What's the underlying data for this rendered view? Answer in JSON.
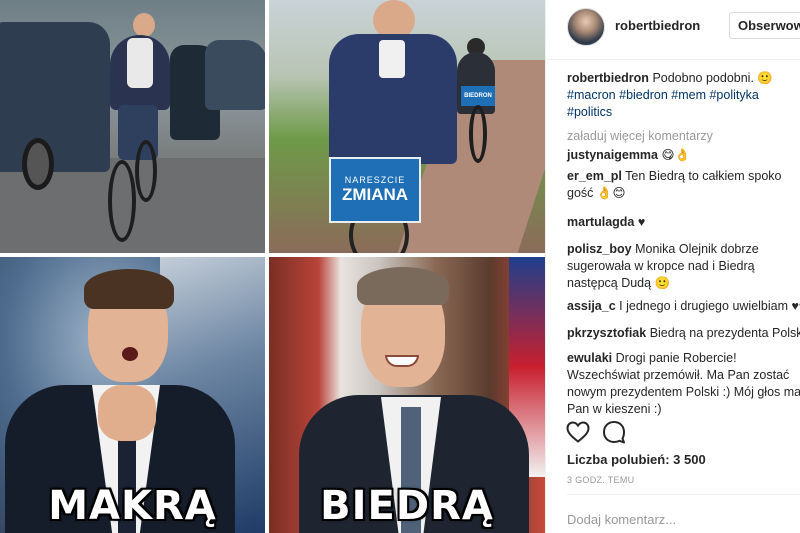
{
  "collage": {
    "sign_line1": "NARESZCIE",
    "sign_line2": "ZMIANA",
    "basket_label": "BIEDRON",
    "label_left": "MAKRĄ",
    "label_right": "BIEDRĄ"
  },
  "post": {
    "username": "robertbiedron",
    "follow_label": "Obserwowanie",
    "caption": {
      "user": "robertbiedron",
      "text": "Podobno podobni. 🙂",
      "hashtags": [
        "#macron",
        "#biedron",
        "#mem",
        "#polityka",
        "#politics"
      ]
    },
    "load_more": "załaduj więcej komentarzy",
    "comments": [
      {
        "user": "justynaigemma",
        "text": "😋👌"
      },
      {
        "user": "er_em_pl",
        "text": "Ten Biedrą to całkiem spoko gość 👌😊"
      },
      {
        "user": "martulagda",
        "text": "♥"
      },
      {
        "user": "polisz_boy",
        "text": "Monika Olejnik dobrze sugerowała w kropce nad i Biedrą następcą Dudą 🙂"
      },
      {
        "user": "assija_c",
        "text": "I jednego i drugiego uwielbiam ♥♥"
      },
      {
        "user": "pkrzysztofiak",
        "text": "Biedrą na prezydenta Polski"
      },
      {
        "user": "ewulaki",
        "text": "Drogi panie Robercie! Wszechświat przemówił. Ma Pan zostać nowym prezydentem Polski :) Mój głos ma Pan w kieszeni :)"
      }
    ],
    "likes": "Liczba polubień: 3 500",
    "time": "3 GODZ. TEMU",
    "add_comment_placeholder": "Dodaj komentarz..."
  },
  "icons": {
    "like": "heart-icon",
    "comment": "comment-icon"
  }
}
